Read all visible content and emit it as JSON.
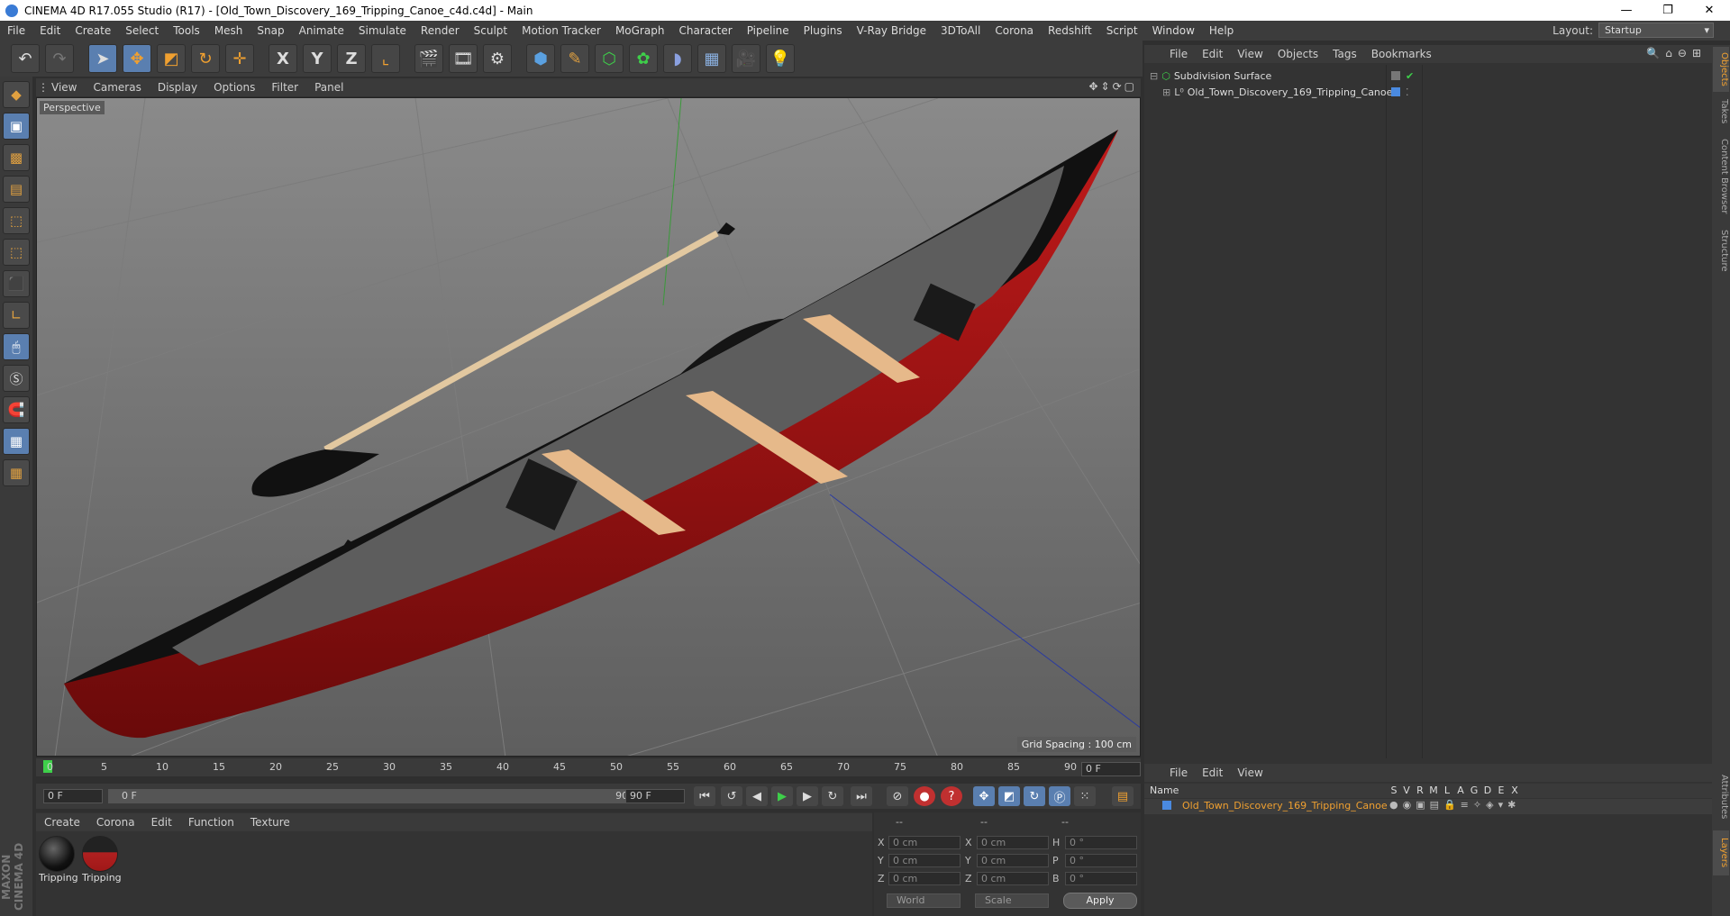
{
  "window": {
    "title": "CINEMA 4D R17.055 Studio (R17) - [Old_Town_Discovery_169_Tripping_Canoe_c4d.c4d] - Main",
    "controls": [
      "minimize",
      "restore",
      "close"
    ]
  },
  "menubar": {
    "items": [
      "File",
      "Edit",
      "Create",
      "Select",
      "Tools",
      "Mesh",
      "Snap",
      "Animate",
      "Simulate",
      "Render",
      "Sculpt",
      "Motion Tracker",
      "MoGraph",
      "Character",
      "Pipeline",
      "Plugins",
      "V-Ray Bridge",
      "3DToAll",
      "Corona",
      "Redshift",
      "Script",
      "Window",
      "Help"
    ],
    "layout_label": "Layout:",
    "layout_value": "Startup"
  },
  "toolbar": {
    "axis_x": "X",
    "axis_y": "Y",
    "axis_z": "Z"
  },
  "viewport": {
    "menu": [
      "View",
      "Cameras",
      "Display",
      "Options",
      "Filter",
      "Panel"
    ],
    "label": "Perspective",
    "grid_spacing": "Grid Spacing : 100 cm"
  },
  "timeline": {
    "ticks": [
      "0",
      "5",
      "10",
      "15",
      "20",
      "25",
      "30",
      "35",
      "40",
      "45",
      "50",
      "55",
      "60",
      "65",
      "70",
      "75",
      "80",
      "85",
      "90"
    ],
    "current_frame_display": "0 F"
  },
  "transport": {
    "start_field": "0 F",
    "range_start": "0 F",
    "range_end": "90 F",
    "end_field": "90 F"
  },
  "material_manager": {
    "menu": [
      "Create",
      "Corona",
      "Edit",
      "Function",
      "Texture"
    ],
    "materials": [
      {
        "name": "Tripping"
      },
      {
        "name": "Tripping"
      }
    ]
  },
  "coordinates": {
    "header": [
      "--",
      "--",
      "--"
    ],
    "rows": [
      {
        "pos_label": "X",
        "pos_value": "0 cm",
        "size_label": "X",
        "size_value": "0 cm",
        "rot_label": "H",
        "rot_value": "0 °"
      },
      {
        "pos_label": "Y",
        "pos_value": "0 cm",
        "size_label": "Y",
        "size_value": "0 cm",
        "rot_label": "P",
        "rot_value": "0 °"
      },
      {
        "pos_label": "Z",
        "pos_value": "0 cm",
        "size_label": "Z",
        "size_value": "0 cm",
        "rot_label": "B",
        "rot_value": "0 °"
      }
    ],
    "mode_select": "World",
    "scale_select": "Scale",
    "apply_label": "Apply"
  },
  "object_manager": {
    "menu": [
      "File",
      "Edit",
      "View",
      "Objects",
      "Tags",
      "Bookmarks"
    ],
    "objects": [
      {
        "name": "Subdivision Surface"
      },
      {
        "name": "Old_Town_Discovery_169_Tripping_Canoe"
      }
    ]
  },
  "layer_manager": {
    "menu": [
      "File",
      "Edit",
      "View"
    ],
    "name_header": "Name",
    "columns": [
      "S",
      "V",
      "R",
      "M",
      "L",
      "A",
      "G",
      "D",
      "E",
      "X"
    ],
    "layers": [
      {
        "name": "Old_Town_Discovery_169_Tripping_Canoe"
      }
    ]
  },
  "side_tabs": [
    "Objects",
    "Takes",
    "Content Browser",
    "Structure",
    "Attributes",
    "Layers"
  ],
  "brand": "MAXON CINEMA 4D",
  "colors": {
    "accent_orange": "#f0a030",
    "canoe_hull": "#a01818",
    "viewport_bg": "#6e6e6e",
    "play_green": "#3ecf4a"
  }
}
